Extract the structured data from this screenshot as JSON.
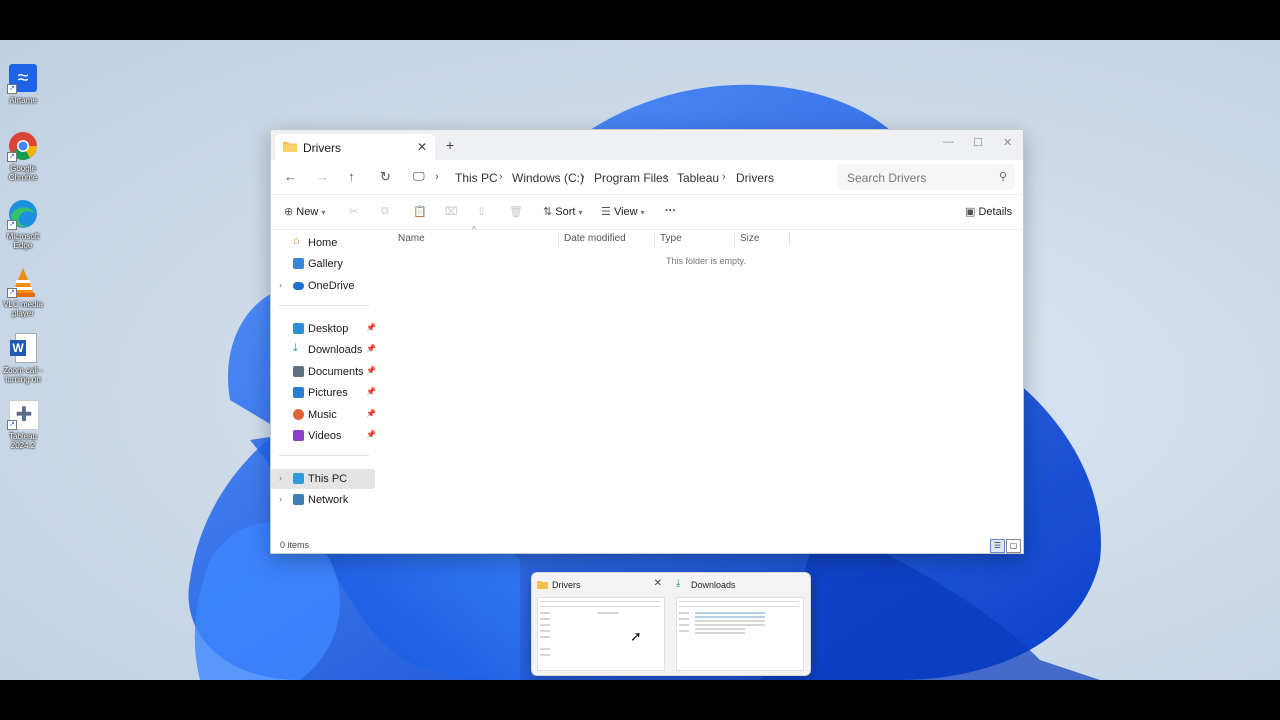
{
  "desktop": {
    "icons": [
      {
        "name": "airtame-icon",
        "label": "Airtame"
      },
      {
        "name": "chrome-icon",
        "label": "Google Chrome"
      },
      {
        "name": "edge-icon",
        "label": "Microsoft Edge"
      },
      {
        "name": "vlc-icon",
        "label": "VLC media player"
      },
      {
        "name": "word-icon",
        "label": "Zoom call - turning on"
      },
      {
        "name": "tableau-icon",
        "label": "Tableau 2024.2"
      }
    ]
  },
  "window": {
    "tab_title": "Drivers",
    "new_tab": "+",
    "tab_close": "✕",
    "controls": {
      "minimize": "—",
      "maximize": "☐",
      "close": "✕"
    },
    "breadcrumb": [
      "This PC",
      "Windows (C:)",
      "Program Files",
      "Tableau",
      "Drivers"
    ],
    "search_placeholder": "Search Drivers",
    "toolbar": {
      "new_label": "New",
      "sort_label": "Sort",
      "view_label": "View",
      "more_label": "···",
      "details_label": "Details"
    },
    "nav": {
      "home": "Home",
      "gallery": "Gallery",
      "onedrive": "OneDrive",
      "desktop": "Desktop",
      "downloads": "Downloads",
      "documents": "Documents",
      "pictures": "Pictures",
      "music": "Music",
      "videos": "Videos",
      "thispc": "This PC",
      "network": "Network"
    },
    "columns": {
      "name": "Name",
      "date": "Date modified",
      "type": "Type",
      "size": "Size"
    },
    "empty_text": "This folder is empty.",
    "status": "0 items"
  },
  "thumbnails": [
    {
      "title": "Drivers"
    },
    {
      "title": "Downloads"
    }
  ],
  "colors": {
    "accent": "#1a73e8",
    "folder": "#f3c04d",
    "selected": "#e4e4e4"
  }
}
